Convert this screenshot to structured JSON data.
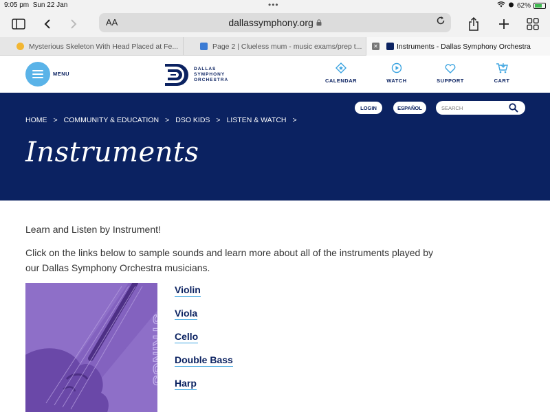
{
  "status": {
    "time": "9:05 pm",
    "date": "Sun 22 Jan",
    "battery_percent": "62%"
  },
  "browser": {
    "text_size_label": "AA",
    "url": "dallassymphony.org",
    "tabs": [
      {
        "title": "Mysterious Skeleton With Head Placed at Fe..."
      },
      {
        "title": "Page 2 | Clueless mum - music exams/prep t..."
      },
      {
        "title": "Instruments - Dallas Symphony Orchestra"
      }
    ]
  },
  "site": {
    "menu_label": "MENU",
    "logo_lines": [
      "DALLAS",
      "SYMPHONY",
      "ORCHESTRA"
    ],
    "nav": [
      {
        "label": "CALENDAR",
        "icon": "calendar-star-icon"
      },
      {
        "label": "WATCH",
        "icon": "play-circle-icon"
      },
      {
        "label": "SUPPORT",
        "icon": "heart-icon"
      },
      {
        "label": "CART",
        "icon": "cart-icon"
      }
    ],
    "login_label": "LOGIN",
    "espanol_label": "ESPAÑOL",
    "search_placeholder": "SEARCH"
  },
  "breadcrumb": [
    "HOME",
    "COMMUNITY & EDUCATION",
    "DSO KIDS",
    "LISTEN & WATCH"
  ],
  "page_title": "Instruments",
  "content": {
    "intro": "Learn and Listen by Instrument!",
    "description": "Click on the links below to sample sounds and learn more about all of the instruments played by our Dallas Symphony Orchestra musicians.",
    "image_label": "STRINGS",
    "instrument_links": [
      "Violin",
      "Viola",
      "Cello",
      "Double Bass",
      "Harp"
    ]
  },
  "colors": {
    "navy": "#0b2261",
    "accent_blue": "#3aa3e0",
    "strings_purple": "#8e6fc8"
  }
}
